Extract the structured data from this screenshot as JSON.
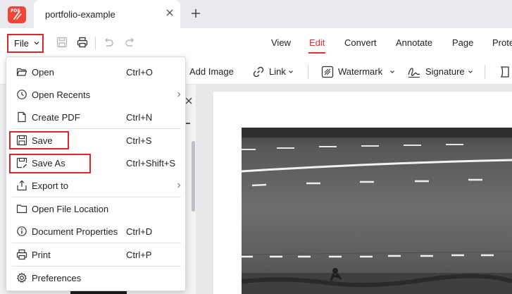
{
  "app": {
    "logo_text": "PDF"
  },
  "tab": {
    "title": "portfolio-example"
  },
  "toolbar": {
    "file_label": "File",
    "nav_tabs": [
      {
        "label": "View"
      },
      {
        "label": "Edit"
      },
      {
        "label": "Convert"
      },
      {
        "label": "Annotate"
      },
      {
        "label": "Page"
      },
      {
        "label": "Prote"
      }
    ],
    "active_tab": "Edit"
  },
  "ribbon": {
    "items": [
      {
        "label": "Add Image",
        "icon": "image-icon"
      },
      {
        "label": "Link",
        "icon": "link-icon"
      },
      {
        "label": "Watermark",
        "icon": "watermark-icon"
      },
      {
        "label": "Signature",
        "icon": "signature-icon"
      }
    ]
  },
  "file_menu": {
    "items": [
      {
        "label": "Open",
        "shortcut": "Ctrl+O",
        "icon": "folder-open-icon"
      },
      {
        "label": "Open Recents",
        "shortcut": "",
        "icon": "clock-icon",
        "submenu": true
      },
      {
        "label": "Create PDF",
        "shortcut": "Ctrl+N",
        "icon": "new-document-icon"
      },
      {
        "label": "Save",
        "shortcut": "Ctrl+S",
        "icon": "save-icon",
        "highlighted": true
      },
      {
        "label": "Save As",
        "shortcut": "Ctrl+Shift+S",
        "icon": "save-as-icon",
        "highlighted": true
      },
      {
        "label": "Export to",
        "shortcut": "",
        "icon": "export-icon",
        "submenu": true
      },
      {
        "label": "Open File Location",
        "shortcut": "",
        "icon": "folder-icon"
      },
      {
        "label": "Document Properties",
        "shortcut": "Ctrl+D",
        "icon": "info-icon"
      },
      {
        "label": "Print",
        "shortcut": "Ctrl+P",
        "icon": "printer-icon"
      },
      {
        "label": "Preferences",
        "shortcut": "",
        "icon": "gear-icon"
      }
    ]
  },
  "colors": {
    "accent": "#e0312b",
    "highlight_border": "#d9252b",
    "brand": "#f0453a"
  }
}
